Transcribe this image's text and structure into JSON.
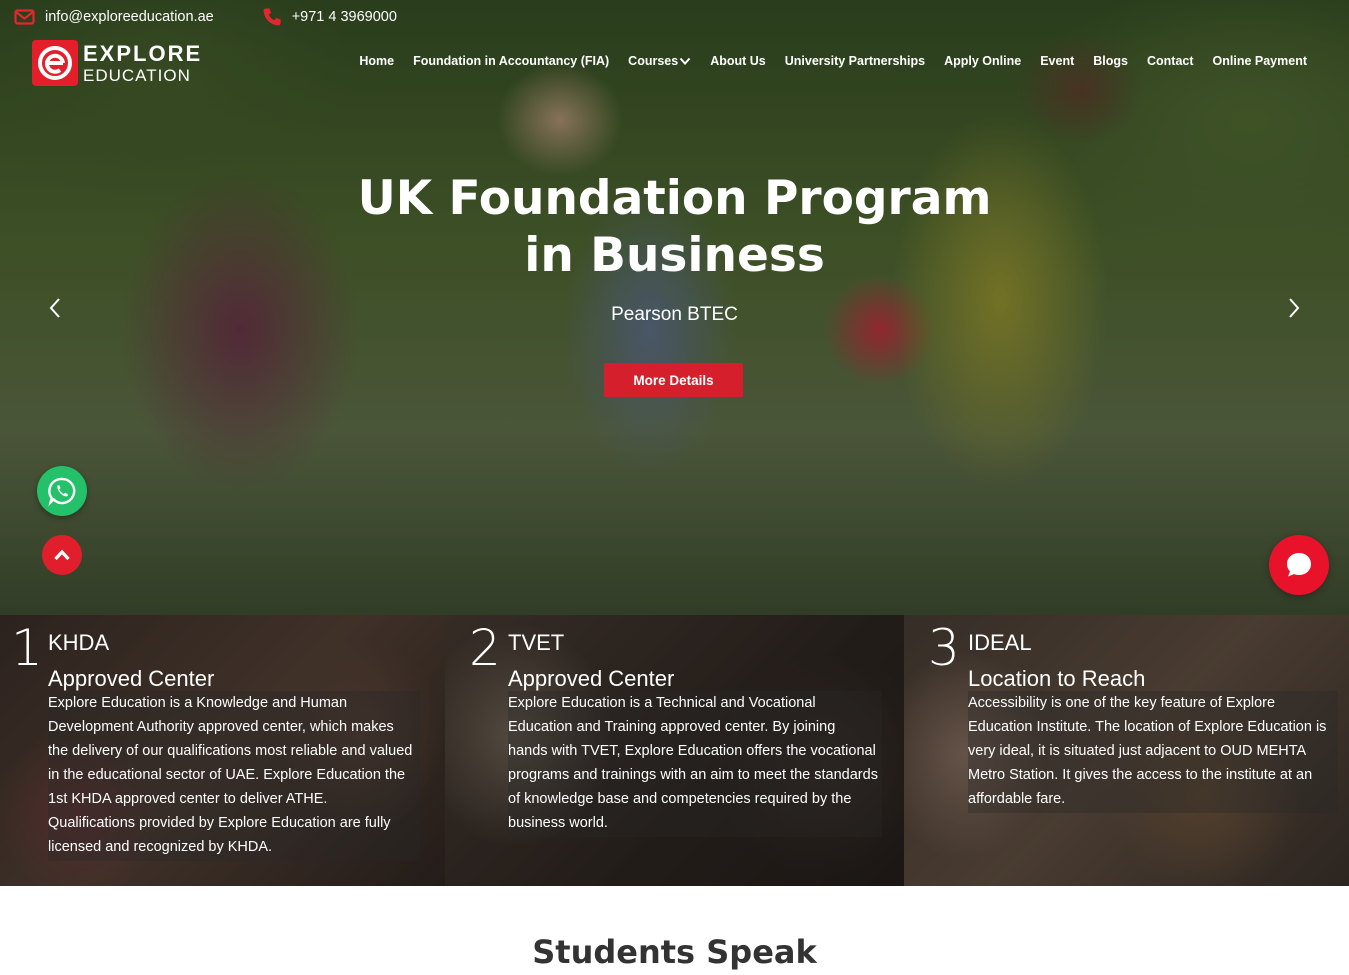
{
  "topbar": {
    "email": "info@exploreeducation.ae",
    "phone": "+971 4 3969000"
  },
  "logo": {
    "line1": "EXPLORE",
    "line2": "EDUCATION"
  },
  "nav": {
    "items": [
      {
        "label": "Home"
      },
      {
        "label": "Foundation in Accountancy (FIA)"
      },
      {
        "label": "Courses"
      },
      {
        "label": "About Us"
      },
      {
        "label": "University Partnerships"
      },
      {
        "label": "Apply Online"
      },
      {
        "label": "Event"
      },
      {
        "label": "Blogs"
      },
      {
        "label": "Contact"
      },
      {
        "label": "Online Payment"
      }
    ]
  },
  "hero": {
    "title_line1": "UK Foundation Program",
    "title_line2": "in Business",
    "subtitle": "Pearson BTEC",
    "button": "More Details"
  },
  "features": [
    {
      "number": "1",
      "title_line1": "KHDA",
      "title_line2": "Approved Center",
      "text": "Explore Education is a Knowledge and Human Development Authority approved center, which makes the delivery of our qualifications most reliable and valued in the educational sector of UAE. Explore Education the 1st KHDA approved center to deliver ATHE. Qualifications provided by Explore Education are fully licensed and recognized by KHDA."
    },
    {
      "number": "2",
      "title_line1": "TVET",
      "title_line2": "Approved Center",
      "text": "Explore Education is a Technical and Vocational Education and Training approved center. By joining hands with TVET, Explore Education offers the vocational programs and trainings with an aim to meet the standards of knowledge base and competencies required by the business world."
    },
    {
      "number": "3",
      "title_line1": "IDEAL",
      "title_line2": "Location to Reach",
      "text": "Accessibility is one of the key feature of Explore Education Institute. The location of Explore Education is very ideal, it is situated just adjacent to OUD MEHTA Metro Station. It gives the access to the institute at an affordable fare."
    }
  ],
  "section": {
    "title": "Students Speak"
  },
  "colors": {
    "accent": "#d61f2c",
    "whatsapp": "#25c06a"
  },
  "icons": [
    "envelope-icon",
    "phone-icon",
    "chevron-down-icon",
    "chevron-left-icon",
    "chevron-right-icon",
    "whatsapp-icon",
    "chevron-up-icon",
    "chat-icon"
  ]
}
